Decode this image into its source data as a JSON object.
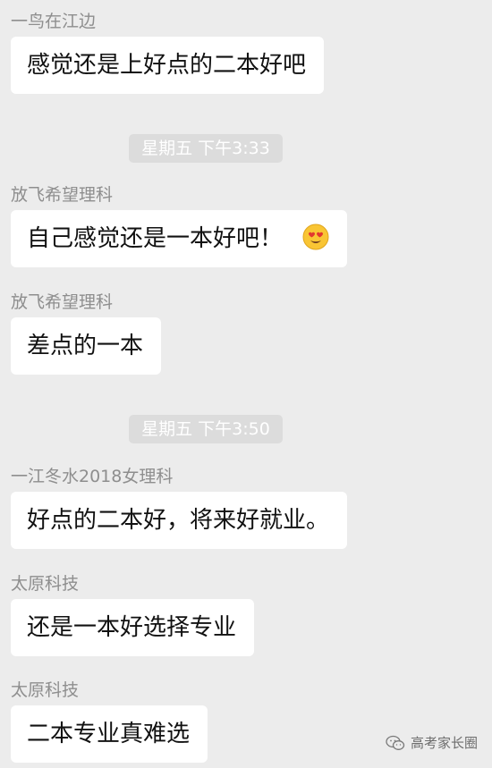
{
  "messages": [
    {
      "sender": "一鸟在江边",
      "text": "感觉还是上好点的二本好吧"
    },
    {
      "sender": "放飞希望理科",
      "text": "自己感觉还是一本好吧！",
      "emoji": "smiling-face-with-heart-eyes"
    },
    {
      "sender": "放飞希望理科",
      "text": "差点的一本"
    },
    {
      "sender": "一江冬水2018女理科",
      "text": "好点的二本好，将来好就业。"
    },
    {
      "sender": "太原科技",
      "text": "还是一本好选择专业"
    },
    {
      "sender": "太原科技",
      "text": "二本专业真难选"
    }
  ],
  "timestamps": [
    "星期五 下午3:33",
    "星期五 下午3:50"
  ],
  "watermark": {
    "icon": "wechat-icon",
    "text": "高考家长圈"
  },
  "colors": {
    "background": "#ececec",
    "bubble": "#ffffff",
    "sender": "#8e8e8e",
    "timestamp_bg": "#dcdcdc"
  }
}
